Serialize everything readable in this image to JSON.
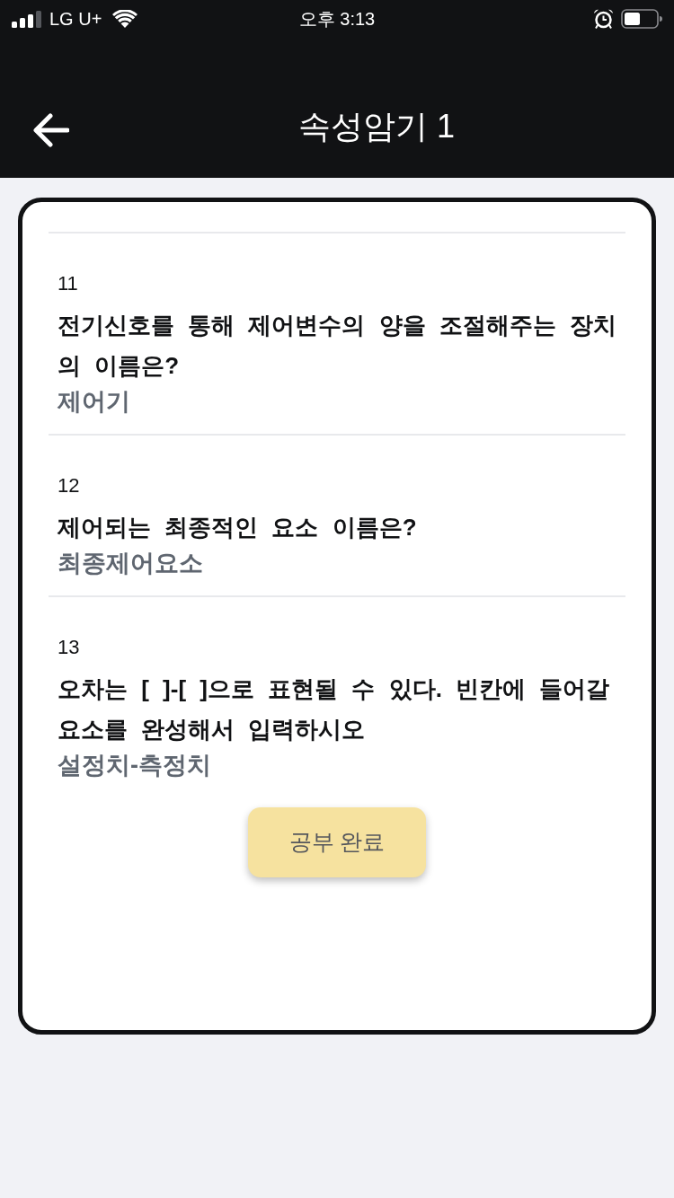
{
  "status_bar": {
    "carrier": "LG U+",
    "time": "오후 3:13"
  },
  "header": {
    "title": "속성암기 1"
  },
  "questions": [
    {
      "number": "11",
      "question": "전기신호를 통해 제어변수의 양을 조절해주는 장치의 이름은?",
      "answer": "제어기"
    },
    {
      "number": "12",
      "question": "제어되는 최종적인 요소 이름은?",
      "answer": "최종제어요소"
    },
    {
      "number": "13",
      "question": "오차는 [ ]-[ ]으로 표현될 수 있다. 빈칸에 들어갈 요소를 완성해서 입력하시오",
      "answer": "설정치-측정치"
    }
  ],
  "button": {
    "label": "공부 완료"
  }
}
